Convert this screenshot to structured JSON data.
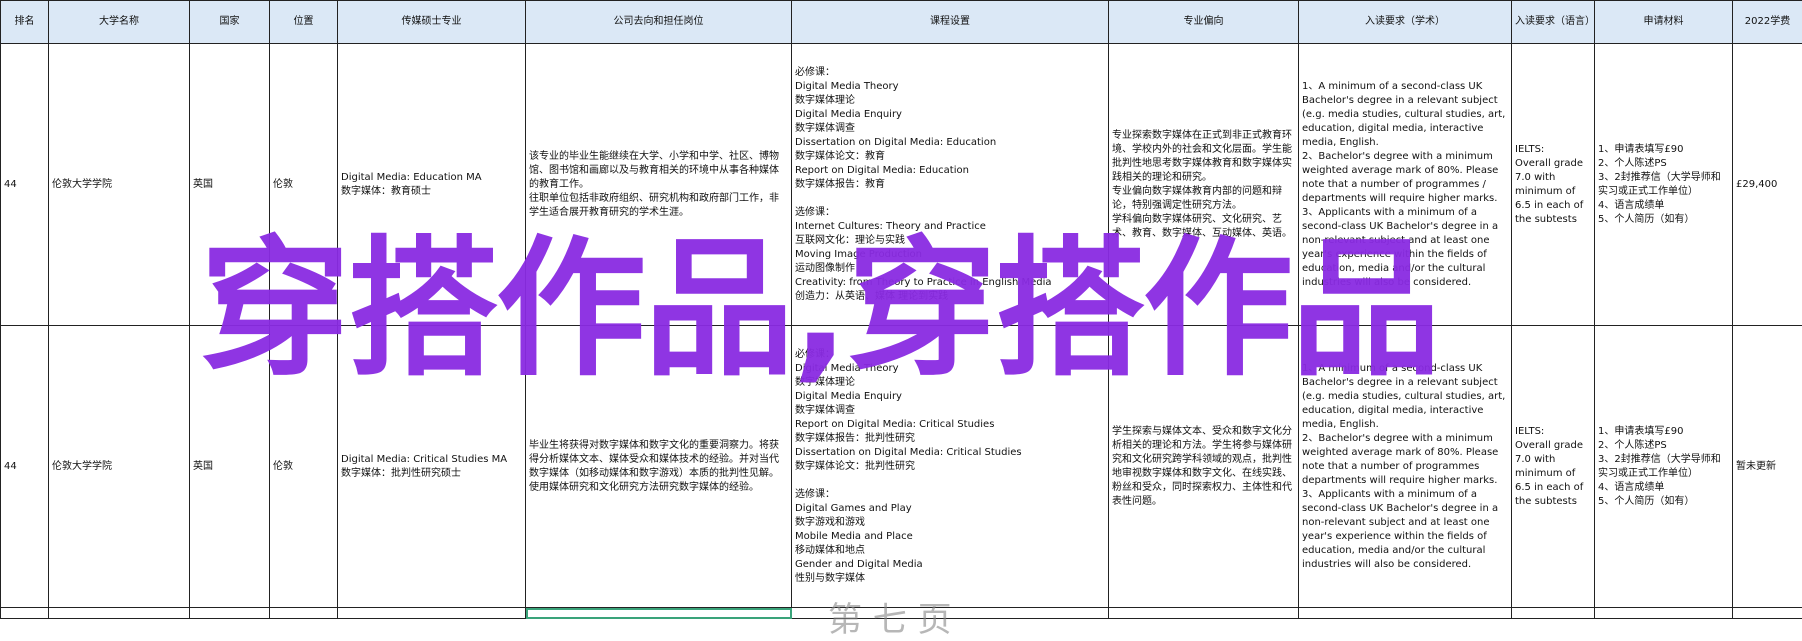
{
  "columns": [
    "排名",
    "大学名称",
    "国家",
    "位置",
    "传媒硕士专业",
    "公司去向和担任岗位",
    "课程设置",
    "专业偏向",
    "入读要求（学术）",
    "入读要求（语言）",
    "申请材料",
    "2022学费"
  ],
  "rows": [
    {
      "rank": "44",
      "university": "伦敦大学学院",
      "country": "英国",
      "location": "伦敦",
      "major": "Digital Media: Education MA\n数字媒体：教育硕士",
      "career": "该专业的毕业生能继续在大学、小学和中学、社区、博物馆、图书馆和画廊以及与教育相关的环境中从事各种媒体的教育工作。\n往职单位包括非政府组织、研究机构和政府部门工作，非学生适合展开教育研究的学术生涯。",
      "courses": "必修课：\nDigital Media Theory\n数字媒体理论\nDigital Media Enquiry\n数字媒体调查\nDissertation on Digital Media: Education\n数字媒体论文：教育\nReport on Digital Media: Education\n数字媒体报告：教育\n\n选修课：\nInternet Cultures: Theory and Practice\n互联网文化：理论与实践\nMoving Image Production\n运动图像制作\nCreativity: from Theory to Practice in English Media\n创造力：从英语、媒体 理论到实践",
      "focus": "专业探索数字媒体在正式到非正式教育环境、学校内外的社会和文化层面。学生能批判性地思考数字媒体教育和数字媒体实践相关的理论和研究。\n专业偏向数字媒体教育内部的问题和辩论，特别强调定性研究方法。\n学科偏向数字媒体研究、文化研究、艺术、教育、数字媒体、互动媒体、英语。",
      "academic": "1、A minimum of a second-class UK Bachelor's degree in a relevant subject (e.g. media studies, cultural studies, art, education, digital media, interactive media, English.\n2、Bachelor's degree with a minimum weighted average mark of 80%. Please note that a number of programmes / departments will require higher marks.\n3、Applicants with a minimum of a second-class UK Bachelor's degree in a non-relevant subject and at least one year's experience within the fields of education, media and/or the cultural industries will also be considered.",
      "language": "IELTS:\nOverall grade 7.0 with minimum of 6.5 in each of the subtests",
      "materials": "1、申请表填写£90\n2、个人陈述PS\n3、2封推荐信（大学导师和实习或正式工作单位）\n4、语言成绩单\n5、个人简历（如有）",
      "fee": "£29,400"
    },
    {
      "rank": "44",
      "university": "伦敦大学学院",
      "country": "英国",
      "location": "伦敦",
      "major": "Digital Media: Critical Studies MA\n数字媒体：批判性研究硕士",
      "career": "毕业生将获得对数字媒体和数字文化的重要洞察力。将获得分析媒体文本、媒体受众和媒体技术的经验。并对当代数字媒体（如移动媒体和数字游戏）本质的批判性见解。使用媒体研究和文化研究方法研究数字媒体的经验。",
      "courses": "必修课：\nDigital Media Theory\n数字媒体理论\nDigital Media Enquiry\n数字媒体调查\nReport on Digital Media: Critical Studies\n数字媒体报告：批判性研究\nDissertation on Digital Media: Critical Studies\n数字媒体论文：批判性研究\n\n选修课：\nDigital Games and Play\n数字游戏和游戏\nMobile Media and Place\n移动媒体和地点\nGender and Digital Media\n性别与数字媒体",
      "focus": "学生探索与媒体文本、受众和数字文化分析相关的理论和方法。学生将参与媒体研究和文化研究跨学科领域的观点，批判性地审视数字媒体和数字文化、在线实践、粉丝和受众，同时探索权力、主体性和代表性问题。",
      "academic": "1、A minimum of a second-class UK Bachelor's degree in a relevant subject (e.g. media studies, cultural studies, art, education, digital media, interactive media, English.\n2、Bachelor's degree with a minimum weighted average mark of 80%. Please note that a number of programmes departments will require higher marks.\n3、Applicants with a minimum of a second-class UK Bachelor's degree in a non-relevant subject and at least one year's experience within the fields of education, media and/or the cultural industries will also be considered.",
      "language": "IELTS:\nOverall grade 7.0 with minimum of 6.5 in each of the subtests",
      "materials": "1、申请表填写£90\n2、个人陈述PS\n3、2封推荐信（大学导师和实习或正式工作单位）\n4、语言成绩单\n5、个人简历（如有）",
      "fee": "暂未更新"
    }
  ],
  "watermark": "穿搭作品,穿搭作品",
  "ghost_text": "第 七 页"
}
